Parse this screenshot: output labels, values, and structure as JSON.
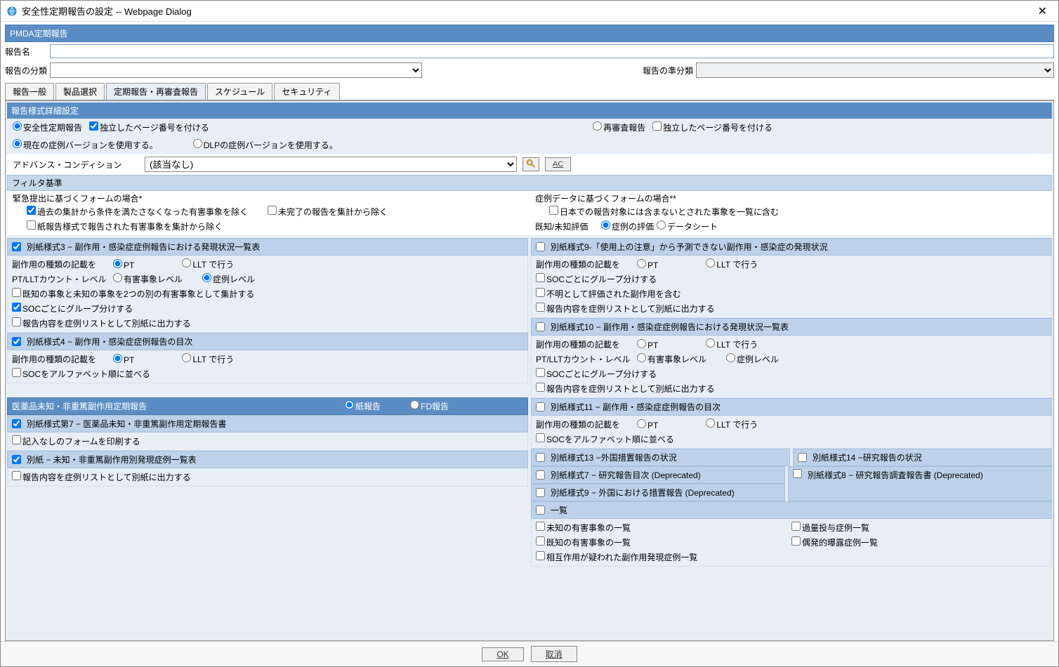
{
  "window": {
    "title": "安全性定期報告の設定 -- Webpage Dialog"
  },
  "header": {
    "title": "PMDA定期報告"
  },
  "form": {
    "report_name_label": "報告名",
    "report_name_value": "",
    "report_class_label": "報告の分類",
    "report_subclass_label": "報告の準分類"
  },
  "tabs": {
    "general": "報告一般",
    "product": "製品選択",
    "periodic": "定期報告・再審査報告",
    "schedule": "スケジュール",
    "security": "セキュリティ"
  },
  "subheader": "報告様式詳細設定",
  "opts1": {
    "safety_report": "安全性定期報告",
    "indep_page_left": "独立したページ番号を付ける",
    "reexam_report": "再審査報告",
    "indep_page_right": "独立したページ番号を付ける",
    "use_current_ver": "現在の症例バージョンを使用する。",
    "use_dlp_ver": "DLPの症例バージョンを使用する。",
    "adv_condition_label": "アドバンス・コンディション",
    "adv_condition_value": "(該当なし)",
    "ac_button": "AC"
  },
  "filter": {
    "header": "フィルタ基準",
    "left_title": "緊急提出に基づくフォームの場合*",
    "right_title": "症例データに基づくフォームの場合**",
    "l1": "過去の集計から条件を満たさなくなった有害事象を除く",
    "l2": "未完了の報告を集計から除く",
    "l3": "紙報告様式で報告された有害事象を集計から除く",
    "r1": "日本での報告対象には含まないとされた事象を一覧に含む",
    "r_eval_label": "既知/未知評価",
    "r_eval_opt1": "症例の評価",
    "r_eval_opt2": "データシート"
  },
  "left_groups": {
    "g3": {
      "header": "別紙様式3 − 副作用・感染症症例報告における発現状況一覧表",
      "type_label": "副作用の種類の記載を",
      "pt": "PT",
      "llt": "LLT で行う",
      "count_label": "PT/LLTカウント・レベル",
      "count_opt1": "有害事象レベル",
      "count_opt2": "症例レベル",
      "c1": "既知の事象と未知の事象を2つの別の有害事象として集計する",
      "c2": "SOCごとにグループ分けする",
      "c3": "報告内容を症例リストとして別紙に出力する"
    },
    "g4": {
      "header": "別紙様式4 − 副作用・感染症症例報告の目次",
      "type_label": "副作用の種類の記載を",
      "pt": "PT",
      "llt": "LLT で行う",
      "c1": "SOCをアルファベット順に並べる"
    },
    "g7": {
      "header": "医薬品未知・非重篤副作用定期報告",
      "opt_paper": "紙報告",
      "opt_fd": "FD報告",
      "sub7": "別紙様式第7 − 医薬品未知・非重篤副作用定期報告書",
      "c_empty": "記入なしのフォームを印刷する",
      "sub_attach": "別紙 − 未知・非重篤副作用別発現症例一覧表",
      "c_out": "報告内容を症例リストとして別紙に出力する"
    }
  },
  "right_groups": {
    "g9": {
      "header": "別紙様式9-「使用上の注意」から予測できない副作用・感染症の発現状況",
      "type_label": "副作用の種類の記載を",
      "pt": "PT",
      "llt": "LLT で行う",
      "c1": "SOCごとにグループ分けする",
      "c2": "不明として評価された副作用を含む",
      "c3": "報告内容を症例リストとして別紙に出力する"
    },
    "g10": {
      "header": "別紙様式10 − 副作用・感染症症例報告における発現状況一覧表",
      "type_label": "副作用の種類の記載を",
      "pt": "PT",
      "llt": "LLT で行う",
      "count_label": "PT/LLTカウント・レベル",
      "count_opt1": "有害事象レベル",
      "count_opt2": "症例レベル",
      "c1": "SOCごとにグループ分けする",
      "c2": "報告内容を症例リストとして別紙に出力する"
    },
    "g11": {
      "header": "別紙様式11 − 副作用・感染症症例報告の目次",
      "type_label": "副作用の種類の記載を",
      "pt": "PT",
      "llt": "LLT で行う",
      "c1": "SOCをアルファベット順に並べる"
    },
    "g13": {
      "header": "別紙様式13 −外国措置報告の状況"
    },
    "g14": {
      "header": "別紙様式14 −研究報告の状況"
    },
    "g7d": {
      "header": "別紙様式7 − 研究報告目次 (Deprecated)"
    },
    "g8d": {
      "header": "別紙様式8 − 研究報告調査報告書 (Deprecated)"
    },
    "g9d": {
      "header": "別紙様式9 − 外国における措置報告 (Deprecated)"
    },
    "list": {
      "header": "一覧",
      "c1": "未知の有害事象の一覧",
      "c2": "既知の有害事象の一覧",
      "c3": "相互作用が疑われた副作用発現症例一覧",
      "c4": "過量投与症例一覧",
      "c5": "偶発的曝露症例一覧"
    }
  },
  "footer": {
    "ok": "OK",
    "cancel": "取消"
  }
}
